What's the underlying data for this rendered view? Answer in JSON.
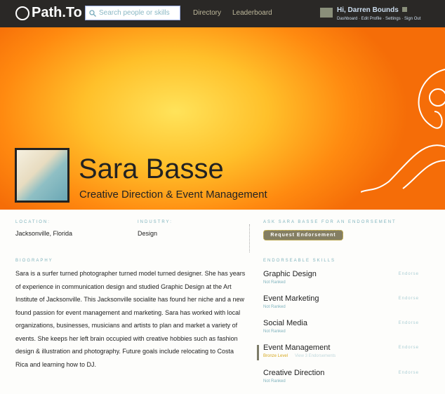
{
  "header": {
    "logo": "Path.To",
    "search_placeholder": "Search people or skills",
    "nav": [
      "Directory",
      "Leaderboard"
    ],
    "greeting": "Hi, Darren Bounds",
    "user_links": "Dashboard · Edit Profile · Settings · Sign Out"
  },
  "profile": {
    "name": "Sara Basse",
    "title": "Creative Direction & Event Management"
  },
  "details": {
    "location_label": "Location:",
    "location": "Jacksonville, Florida",
    "industry_label": "Industry:",
    "industry": "Design",
    "bio_label": "Biography",
    "bio": "Sara is a surfer turned photographer turned model turned designer. She has years of experience in communication design and studied Graphic Design at the Art Institute of Jacksonville. This Jacksonville socialite has found her niche and a new found passion for event management and marketing. Sara has worked with local organizations, businesses, musicians and artists to plan and market a variety of events. She keeps her left brain occupied with creative hobbies such as fashion design & illustration and photography. Future goals include relocating to Costa Rica and learning how to DJ."
  },
  "endorse": {
    "ask_label": "Ask Sara Basse for an endorsement",
    "button": "Request Endorsement",
    "skills_label": "Endorseable Skills",
    "endorse_label": "Endorse",
    "skills": [
      {
        "name": "Graphic Design",
        "rank": "Not Ranked"
      },
      {
        "name": "Event Marketing",
        "rank": "Not Ranked"
      },
      {
        "name": "Social Media",
        "rank": "Not Ranked"
      },
      {
        "name": "Event Management",
        "rank": "Bronze Level",
        "extra": "View 3 Endorsements"
      },
      {
        "name": "Creative Direction",
        "rank": "Not Ranked"
      }
    ]
  }
}
